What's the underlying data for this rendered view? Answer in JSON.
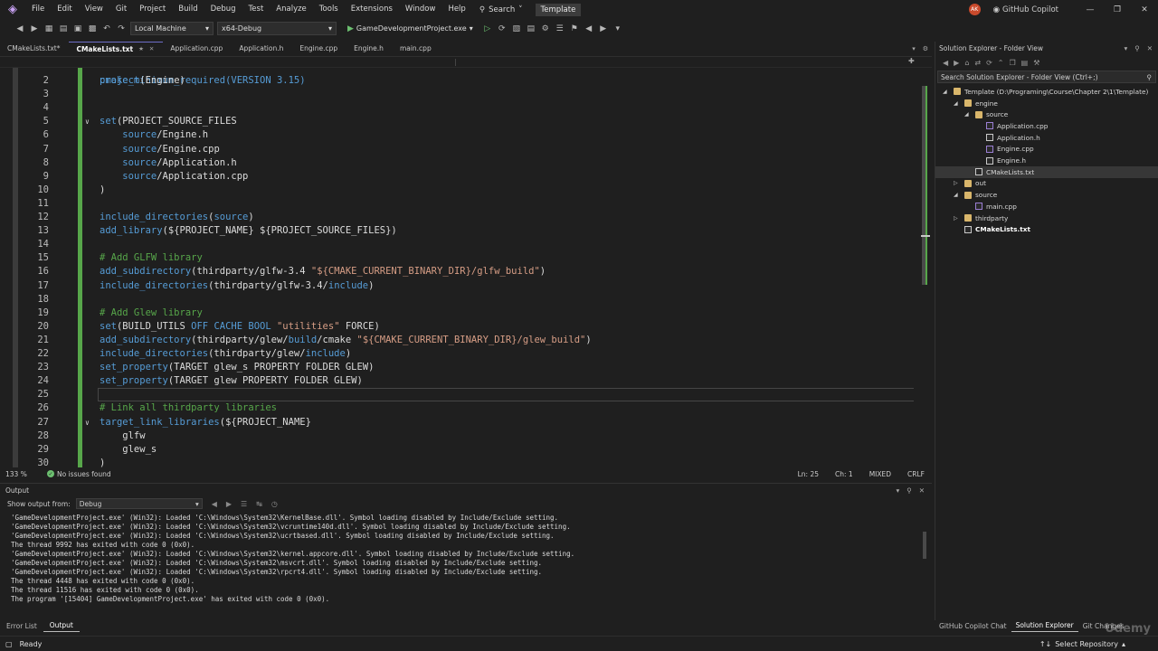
{
  "menu": {
    "items": [
      "File",
      "Edit",
      "View",
      "Git",
      "Project",
      "Build",
      "Debug",
      "Test",
      "Analyze",
      "Tools",
      "Extensions",
      "Window",
      "Help"
    ],
    "search_label": "Search",
    "template_label": "Template",
    "avatar_initials": "AK",
    "copilot_label": "GitHub Copilot"
  },
  "toolbar": {
    "target_label": "Local Machine",
    "config_label": "x64-Debug",
    "run_label": "GameDevelopmentProject.exe"
  },
  "tabs": [
    {
      "label": "CMakeLists.txt*",
      "active": false
    },
    {
      "label": "CMakeLists.txt",
      "active": true
    },
    {
      "label": "Application.cpp",
      "active": false
    },
    {
      "label": "Application.h",
      "active": false
    },
    {
      "label": "Engine.cpp",
      "active": false
    },
    {
      "label": "Engine.h",
      "active": false
    },
    {
      "label": "main.cpp",
      "active": false
    }
  ],
  "editor": {
    "line1_partial": "cmake_minimum_required(VERSION 3.15)",
    "lines": [
      {
        "n": "2",
        "tokens": [
          [
            "t-fn",
            "project"
          ],
          [
            "t-plain",
            "(Engine)"
          ]
        ]
      },
      {
        "n": "3",
        "tokens": []
      },
      {
        "n": "4",
        "tokens": []
      },
      {
        "n": "5",
        "fold": true,
        "tokens": [
          [
            "t-fn",
            "set"
          ],
          [
            "t-plain",
            "(PROJECT_SOURCE_FILES"
          ]
        ]
      },
      {
        "n": "6",
        "tokens": [
          [
            "t-plain",
            "    "
          ],
          [
            "t-fn",
            "source"
          ],
          [
            "t-plain",
            "/Engine.h"
          ]
        ]
      },
      {
        "n": "7",
        "tokens": [
          [
            "t-plain",
            "    "
          ],
          [
            "t-fn",
            "source"
          ],
          [
            "t-plain",
            "/Engine.cpp"
          ]
        ]
      },
      {
        "n": "8",
        "tokens": [
          [
            "t-plain",
            "    "
          ],
          [
            "t-fn",
            "source"
          ],
          [
            "t-plain",
            "/Application.h"
          ]
        ]
      },
      {
        "n": "9",
        "tokens": [
          [
            "t-plain",
            "    "
          ],
          [
            "t-fn",
            "source"
          ],
          [
            "t-plain",
            "/Application.cpp"
          ]
        ]
      },
      {
        "n": "10",
        "tokens": [
          [
            "t-plain",
            ")"
          ]
        ]
      },
      {
        "n": "11",
        "tokens": []
      },
      {
        "n": "12",
        "tokens": [
          [
            "t-fn",
            "include_directories"
          ],
          [
            "t-plain",
            "("
          ],
          [
            "t-fn",
            "source"
          ],
          [
            "t-plain",
            ")"
          ]
        ]
      },
      {
        "n": "13",
        "tokens": [
          [
            "t-fn",
            "add_library"
          ],
          [
            "t-plain",
            "(${PROJECT_NAME} ${PROJECT_SOURCE_FILES})"
          ]
        ]
      },
      {
        "n": "14",
        "tokens": []
      },
      {
        "n": "15",
        "tokens": [
          [
            "t-com",
            "# Add GLFW library"
          ]
        ]
      },
      {
        "n": "16",
        "tokens": [
          [
            "t-fn",
            "add_subdirectory"
          ],
          [
            "t-plain",
            "(thirdparty/glfw-3.4 "
          ],
          [
            "t-str",
            "\"${CMAKE_CURRENT_BINARY_DIR}/glfw_build\""
          ],
          [
            "t-plain",
            ")"
          ]
        ]
      },
      {
        "n": "17",
        "tokens": [
          [
            "t-fn",
            "include_directories"
          ],
          [
            "t-plain",
            "(thirdparty/glfw-3.4/"
          ],
          [
            "t-fn",
            "include"
          ],
          [
            "t-plain",
            ")"
          ]
        ]
      },
      {
        "n": "18",
        "tokens": []
      },
      {
        "n": "19",
        "tokens": [
          [
            "t-com",
            "# Add Glew library"
          ]
        ]
      },
      {
        "n": "20",
        "tokens": [
          [
            "t-fn",
            "set"
          ],
          [
            "t-plain",
            "(BUILD_UTILS "
          ],
          [
            "t-key",
            "OFF CACHE BOOL "
          ],
          [
            "t-str",
            "\"utilities\""
          ],
          [
            "t-plain",
            " FORCE)"
          ]
        ]
      },
      {
        "n": "21",
        "tokens": [
          [
            "t-fn",
            "add_subdirectory"
          ],
          [
            "t-plain",
            "(thirdparty/glew/"
          ],
          [
            "t-fn",
            "build"
          ],
          [
            "t-plain",
            "/cmake "
          ],
          [
            "t-str",
            "\"${CMAKE_CURRENT_BINARY_DIR}/glew_build\""
          ],
          [
            "t-plain",
            ")"
          ]
        ]
      },
      {
        "n": "22",
        "tokens": [
          [
            "t-fn",
            "include_directories"
          ],
          [
            "t-plain",
            "(thirdparty/glew/"
          ],
          [
            "t-fn",
            "include"
          ],
          [
            "t-plain",
            ")"
          ]
        ]
      },
      {
        "n": "23",
        "tokens": [
          [
            "t-fn",
            "set_property"
          ],
          [
            "t-plain",
            "(TARGET glew_s PROPERTY FOLDER GLEW)"
          ]
        ]
      },
      {
        "n": "24",
        "tokens": [
          [
            "t-fn",
            "set_property"
          ],
          [
            "t-plain",
            "(TARGET glew PROPERTY FOLDER GLEW)"
          ]
        ]
      },
      {
        "n": "25",
        "current": true,
        "tokens": []
      },
      {
        "n": "26",
        "tokens": [
          [
            "t-com",
            "# Link all thirdparty libraries"
          ]
        ]
      },
      {
        "n": "27",
        "fold": true,
        "tokens": [
          [
            "t-fn",
            "target_link_libraries"
          ],
          [
            "t-plain",
            "(${PROJECT_NAME}"
          ]
        ]
      },
      {
        "n": "28",
        "tokens": [
          [
            "t-plain",
            "    glfw"
          ]
        ]
      },
      {
        "n": "29",
        "tokens": [
          [
            "t-plain",
            "    glew_s"
          ]
        ]
      },
      {
        "n": "30",
        "tokens": [
          [
            "t-plain",
            ")"
          ]
        ]
      }
    ]
  },
  "editor_status": {
    "zoom": "133 %",
    "issues": "No issues found",
    "ln": "Ln: 25",
    "ch": "Ch: 1",
    "mode": "MIXED",
    "eol": "CRLF"
  },
  "output": {
    "title": "Output",
    "show_from_label": "Show output from:",
    "source": "Debug",
    "lines": [
      "'GameDevelopmentProject.exe' (Win32): Loaded 'C:\\Windows\\System32\\KernelBase.dll'. Symbol loading disabled by Include/Exclude setting.",
      "'GameDevelopmentProject.exe' (Win32): Loaded 'C:\\Windows\\System32\\vcruntime140d.dll'. Symbol loading disabled by Include/Exclude setting.",
      "'GameDevelopmentProject.exe' (Win32): Loaded 'C:\\Windows\\System32\\ucrtbased.dll'. Symbol loading disabled by Include/Exclude setting.",
      "The thread 9992 has exited with code 0 (0x0).",
      "'GameDevelopmentProject.exe' (Win32): Loaded 'C:\\Windows\\System32\\kernel.appcore.dll'. Symbol loading disabled by Include/Exclude setting.",
      "'GameDevelopmentProject.exe' (Win32): Loaded 'C:\\Windows\\System32\\msvcrt.dll'. Symbol loading disabled by Include/Exclude setting.",
      "'GameDevelopmentProject.exe' (Win32): Loaded 'C:\\Windows\\System32\\rpcrt4.dll'. Symbol loading disabled by Include/Exclude setting.",
      "The thread 4448 has exited with code 0 (0x0).",
      "The thread 11516 has exited with code 0 (0x0).",
      "The program '[15404] GameDevelopmentProject.exe' has exited with code 0 (0x0)."
    ]
  },
  "bottom_tabs": [
    "Error List",
    "Output"
  ],
  "solution": {
    "title": "Solution Explorer - Folder View",
    "search_placeholder": "Search Solution Explorer - Folder View (Ctrl+;)",
    "tree": [
      {
        "label": "Template (D:\\Programing\\Course\\Chapter 2\\1\\Template)",
        "depth": 0,
        "arrow": "open",
        "icon": "folder"
      },
      {
        "label": "engine",
        "depth": 1,
        "arrow": "open",
        "icon": "folder"
      },
      {
        "label": "source",
        "depth": 2,
        "arrow": "open",
        "icon": "folder"
      },
      {
        "label": "Application.cpp",
        "depth": 3,
        "icon": "cpp"
      },
      {
        "label": "Application.h",
        "depth": 3,
        "icon": "file"
      },
      {
        "label": "Engine.cpp",
        "depth": 3,
        "icon": "cpp"
      },
      {
        "label": "Engine.h",
        "depth": 3,
        "icon": "file"
      },
      {
        "label": "CMakeLists.txt",
        "depth": 2,
        "icon": "file",
        "selected": true
      },
      {
        "label": "out",
        "depth": 1,
        "arrow": "closed",
        "icon": "folder"
      },
      {
        "label": "source",
        "depth": 1,
        "arrow": "open",
        "icon": "folder"
      },
      {
        "label": "main.cpp",
        "depth": 2,
        "icon": "cpp"
      },
      {
        "label": "thirdparty",
        "depth": 1,
        "arrow": "closed",
        "icon": "folder"
      },
      {
        "label": "CMakeLists.txt",
        "depth": 1,
        "icon": "file",
        "bold": true
      }
    ]
  },
  "right_tabs": [
    "GitHub Copilot Chat",
    "Solution Explorer",
    "Git Changes"
  ],
  "statusbar": {
    "ready": "Ready",
    "repo": "Select Repository",
    "watermark": "Udemy"
  }
}
